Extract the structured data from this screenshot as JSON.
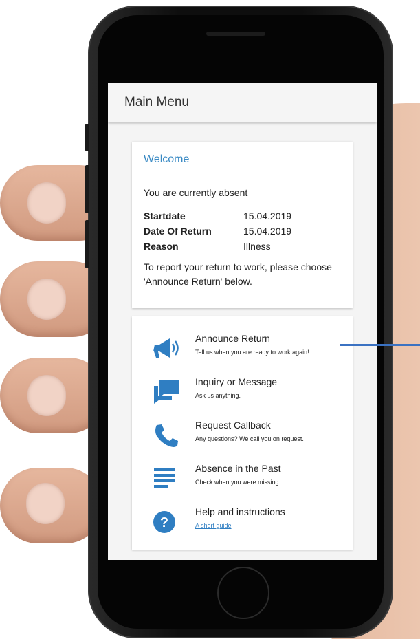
{
  "appbar": {
    "title": "Main Menu"
  },
  "welcome": {
    "title": "Welcome",
    "status": "You are currently absent",
    "rows": [
      {
        "label": "Startdate",
        "value": "15.04.2019"
      },
      {
        "label": "Date Of Return",
        "value": "15.04.2019"
      },
      {
        "label": "Reason",
        "value": "Illness"
      }
    ],
    "instruction": "To report your return to work, please choose 'Announce Return' below."
  },
  "menu": {
    "items": [
      {
        "label": "Announce Return",
        "sub": "Tell us when you are ready to work again!",
        "icon": "megaphone-icon"
      },
      {
        "label": "Inquiry or Message",
        "sub": "Ask us anything.",
        "icon": "chat-icon"
      },
      {
        "label": "Request Callback",
        "sub": "Any questions? We call you on request.",
        "icon": "phone-icon"
      },
      {
        "label": "Absence in the Past",
        "sub": "Check when you were missing.",
        "icon": "list-icon"
      },
      {
        "label": "Help and instructions",
        "sub": "A short guide",
        "icon": "help-icon"
      }
    ]
  },
  "colors": {
    "accent": "#3a8ac4",
    "icon": "#2f7ec2",
    "callout": "#3b72c2"
  }
}
